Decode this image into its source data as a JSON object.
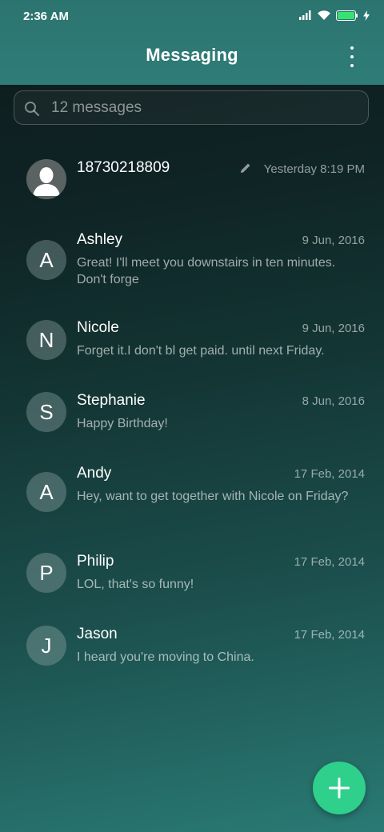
{
  "status_bar": {
    "time": "2:36 AM"
  },
  "header": {
    "title": "Messaging"
  },
  "search": {
    "placeholder": "12 messages"
  },
  "colors": {
    "accent": "#2fd08c",
    "header": "#2f7d78"
  },
  "conversations": [
    {
      "avatar": "",
      "name": "18730218809",
      "date": "Yesterday 8:19 PM",
      "snippet": "",
      "draft_icon": "pencil-icon"
    },
    {
      "avatar": "A",
      "name": "Ashley",
      "date": "9 Jun, 2016",
      "snippet": "Great! I'll meet you downstairs in ten minutes. Don't forge"
    },
    {
      "avatar": "N",
      "name": "Nicole",
      "date": "9 Jun, 2016",
      "snippet": "Forget it.I don't bl get paid. until next Friday."
    },
    {
      "avatar": "S",
      "name": "Stephanie",
      "date": "8 Jun, 2016",
      "snippet": "Happy Birthday!"
    },
    {
      "avatar": "A",
      "name": "Andy",
      "date": "17 Feb, 2014",
      "snippet": "Hey, want to get together with Nicole on Friday?"
    },
    {
      "avatar": "P",
      "name": "Philip",
      "date": "17 Feb, 2014",
      "snippet": "LOL, that's so funny!"
    },
    {
      "avatar": "J",
      "name": "Jason",
      "date": "17 Feb, 2014",
      "snippet": "I heard you're moving to China."
    }
  ]
}
